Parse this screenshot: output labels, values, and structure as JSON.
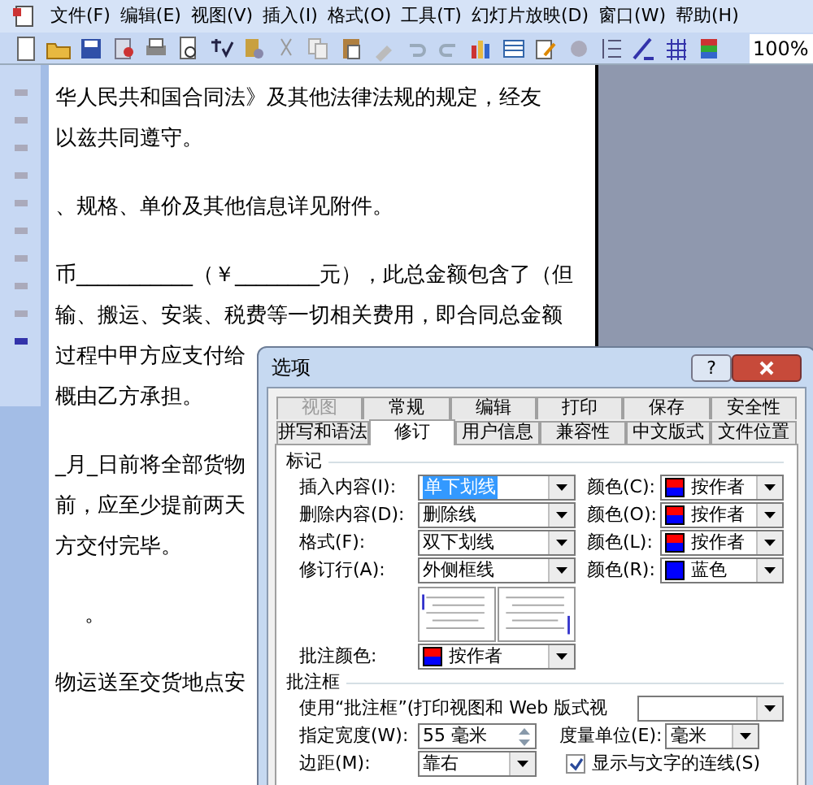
{
  "menu_bar": {
    "items": [
      "文件(F)",
      "编辑(E)",
      "视图(V)",
      "插入(I)",
      "格式(O)",
      "工具(T)",
      "幻灯片放映(D)",
      "窗口(W)",
      "帮助(H)"
    ]
  },
  "toolbar": {
    "zoom": "100%"
  },
  "document": {
    "paragraphs": [
      {
        "indent": false,
        "lines": [
          "华人民共和国合同法》及其他法律法规的规定，经友",
          "以兹共同遵守。"
        ]
      },
      {
        "indent": false,
        "lines": [
          "、规格、单价及其他信息详见附件。"
        ]
      },
      {
        "indent": false,
        "lines": [
          "币___________（￥________元），此总金额包含了（但",
          "输、搬运、安装、税费等一切相关费用，即合同总金额",
          "过程中甲方应支付给",
          "概由乙方承担。"
        ]
      },
      {
        "indent": false,
        "lines": [
          "_月_日前将全部货物",
          "前，应至少提前两天",
          "方交付完毕。"
        ]
      },
      {
        "indent": true,
        "lines": [
          "。"
        ]
      },
      {
        "indent": false,
        "lines": [
          "物运送至交货地点安"
        ]
      }
    ]
  },
  "dialog": {
    "title": "选项",
    "help_button": "?",
    "tabs_back": [
      {
        "label": "视图",
        "selected": false,
        "disabled": true
      },
      {
        "label": "常规",
        "selected": false,
        "disabled": false
      },
      {
        "label": "编辑",
        "selected": false,
        "disabled": false
      },
      {
        "label": "打印",
        "selected": false,
        "disabled": false
      },
      {
        "label": "保存",
        "selected": false,
        "disabled": false
      },
      {
        "label": "安全性",
        "selected": false,
        "disabled": false
      }
    ],
    "tabs_front": [
      {
        "label": "拼写和语法",
        "selected": false,
        "disabled": false
      },
      {
        "label": "修订",
        "selected": true,
        "disabled": false
      },
      {
        "label": "用户信息",
        "selected": false,
        "disabled": false
      },
      {
        "label": "兼容性",
        "selected": false,
        "disabled": false
      },
      {
        "label": "中文版式",
        "selected": false,
        "disabled": false
      },
      {
        "label": "文件位置",
        "selected": false,
        "disabled": false
      }
    ],
    "markup": {
      "heading": "标记",
      "rows": [
        {
          "label": "插入内容(I):",
          "value": "单下划线",
          "focused": true,
          "color_label": "颜色(C):",
          "color_value": "按作者",
          "kind": "split"
        },
        {
          "label": "删除内容(D):",
          "value": "删除线",
          "focused": false,
          "color_label": "颜色(O):",
          "color_value": "按作者",
          "kind": "split"
        },
        {
          "label": "格式(F):",
          "value": "双下划线",
          "focused": false,
          "color_label": "颜色(L):",
          "color_value": "按作者",
          "kind": "split"
        },
        {
          "label": "修订行(A):",
          "value": "外侧框线",
          "focused": false,
          "color_label": "颜色(R):",
          "color_value": "蓝色",
          "kind": "solid",
          "color": "#0000ff"
        }
      ],
      "comment_color": {
        "label": "批注颜色:",
        "value": "按作者",
        "kind": "split"
      }
    },
    "balloons": {
      "heading": "批注框",
      "use_label": "使用“批注框”(打印视图和 Web 版式视",
      "width_label": "指定宽度(W):",
      "width_value": "55 毫米",
      "unit_label": "度量单位(E):",
      "unit_value": "毫米",
      "margin_label": "边距(M):",
      "margin_value": "靠右",
      "show_lines": {
        "label": "显示与文字的连线(S)",
        "checked": true
      }
    }
  }
}
